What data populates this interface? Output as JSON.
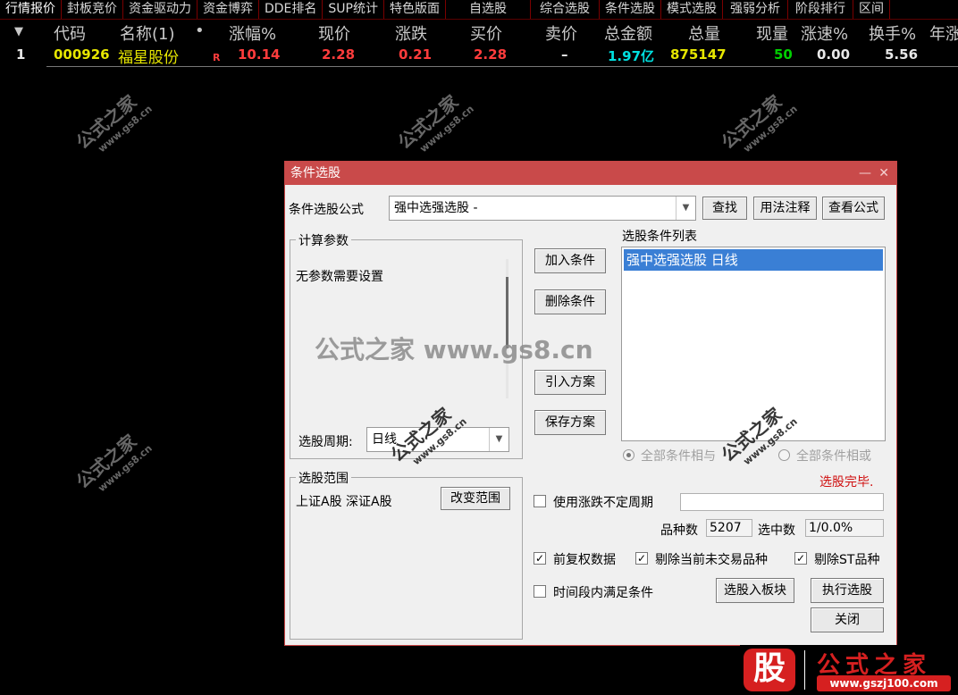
{
  "tabs": [
    "行情报价",
    "封板竞价",
    "资金驱动力",
    "资金博弈",
    "DDE排名",
    "SUP统计",
    "特色版面",
    "自选股",
    "综合选股",
    "条件选股",
    "模式选股",
    "强弱分析",
    "阶段排行",
    "区间"
  ],
  "quote_table": {
    "columns": {
      "sort": "▼",
      "code": "代码",
      "name": "名称(1)",
      "dot": "•",
      "change_pct": "涨幅%",
      "price": "现价",
      "change": "涨跌",
      "bid": "买价",
      "ask": "卖价",
      "amount": "总金额",
      "volume": "总量",
      "cur_vol": "现量",
      "speed": "涨速%",
      "turnover": "换手%",
      "year": "年涨"
    },
    "row": {
      "index": "1",
      "code": "000926",
      "name": "福星股份",
      "flag": "R",
      "change_pct": "10.14",
      "price": "2.28",
      "change": "0.21",
      "bid": "2.28",
      "ask": "–",
      "amount": "1.97亿",
      "volume": "875147",
      "cur_vol": "50",
      "speed": "0.00",
      "turnover": "5.56"
    }
  },
  "colors": {
    "red": "#ff3c3c",
    "yellow": "#e6e600",
    "cyan": "#00e0e0",
    "green": "#00d000",
    "white": "#e8e8e8",
    "title_bar": "#c94a4a",
    "selection": "#3a7fd5"
  },
  "watermarks": {
    "small_a": "公式之家",
    "small_b": "www.gs8.cn",
    "big": "公式之家 www.gs8.cn"
  },
  "dialog": {
    "title": "条件选股",
    "min_glyph": "—",
    "close_glyph": "✕",
    "formula_label": "条件选股公式",
    "formula_value": "强中选强选股  -",
    "find_btn": "查找",
    "usage_btn": "用法注释",
    "view_btn": "查看公式",
    "params_group": "计算参数",
    "params_text": "无参数需要设置",
    "period_label": "选股周期:",
    "period_value": "日线",
    "scope_group": "选股范围",
    "scope_text": "上证A股 深证A股",
    "change_scope_btn": "改变范围",
    "add_btn": "加入条件",
    "del_btn": "删除条件",
    "import_btn": "引入方案",
    "save_btn": "保存方案",
    "cond_list_label": "选股条件列表",
    "cond_item": "强中选强选股  日线",
    "radio_and": "全部条件相与",
    "radio_or": "全部条件相或",
    "status": "选股完毕.",
    "uncertain_period": "使用涨跌不定周期",
    "count_label": "品种数",
    "count_value": "5207",
    "selected_label": "选中数",
    "selected_value": "1/0.0%",
    "chk_adjust": "前复权数据",
    "chk_untraded": "剔除当前未交易品种",
    "chk_st": "剔除ST品种",
    "chk_interval": "时间段内满足条件",
    "to_block_btn": "选股入板块",
    "run_btn": "执行选股",
    "close_btn": "关闭",
    "check_mark": "✓",
    "dropdown_glyph": "▼"
  },
  "logo": {
    "gu": "股",
    "name": "公式之家",
    "url": "www.gszj100.com"
  }
}
